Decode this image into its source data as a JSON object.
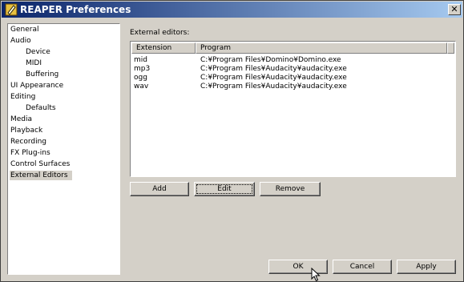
{
  "window": {
    "title": "REAPER Preferences",
    "close_glyph": "✕"
  },
  "tree": {
    "items": [
      {
        "label": "General"
      },
      {
        "label": "Audio"
      },
      {
        "label": "Device"
      },
      {
        "label": "MIDI"
      },
      {
        "label": "Buffering"
      },
      {
        "label": "UI Appearance"
      },
      {
        "label": "Editing"
      },
      {
        "label": "Defaults"
      },
      {
        "label": "Media"
      },
      {
        "label": "Playback"
      },
      {
        "label": "Recording"
      },
      {
        "label": "FX Plug-ins"
      },
      {
        "label": "Control Surfaces"
      },
      {
        "label": "External Editors"
      }
    ],
    "selected": "External Editors"
  },
  "external_editors": {
    "label": "External editors:",
    "columns": [
      "Extension",
      "Program"
    ],
    "rows": [
      {
        "extension": "mid",
        "program": "C:¥Program Files¥Domino¥Domino.exe"
      },
      {
        "extension": "mp3",
        "program": "C:¥Program Files¥Audacity¥audacity.exe"
      },
      {
        "extension": "ogg",
        "program": "C:¥Program Files¥Audacity¥audacity.exe"
      },
      {
        "extension": "wav",
        "program": "C:¥Program Files¥Audacity¥audacity.exe"
      }
    ]
  },
  "buttons": {
    "add": "Add",
    "edit": "Edit",
    "remove": "Remove",
    "ok": "OK",
    "cancel": "Cancel",
    "apply": "Apply"
  },
  "icons": {
    "app": "reaper-app-icon",
    "close": "close-icon",
    "cursor": "mouse-pointer-icon"
  },
  "colors": {
    "titlebar_start": "#0a246a",
    "titlebar_end": "#a6caf0",
    "face": "#d4d0c8"
  }
}
